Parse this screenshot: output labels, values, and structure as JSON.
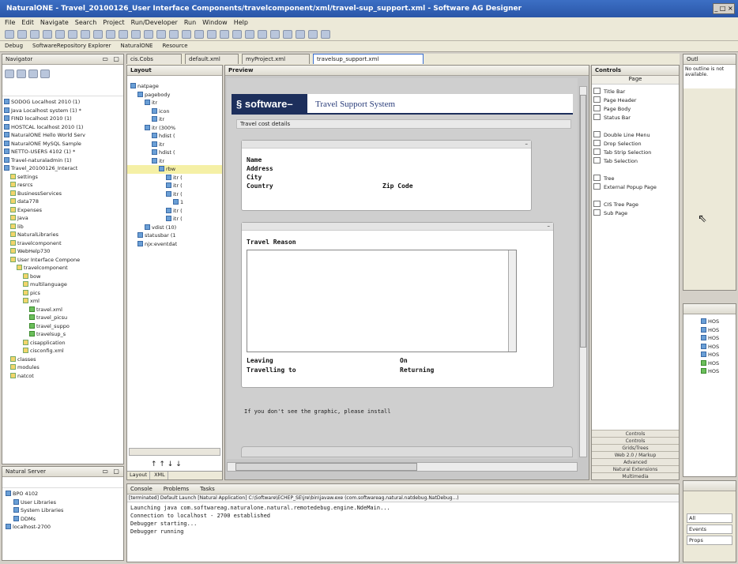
{
  "window": {
    "title": "NaturalONE - Travel_20100126_User Interface Components/travelcomponent/xml/travel-sup_support.xml - Software AG Designer",
    "controls": "_ □ ×"
  },
  "menu": [
    "File",
    "Edit",
    "Navigate",
    "Search",
    "Project",
    "Run/Developer",
    "Run",
    "Window",
    "Help"
  ],
  "perspectives": [
    "Debug",
    "SoftwareRepository Explorer",
    "NaturalONE",
    "Resource"
  ],
  "navigator": {
    "title": "Navigator",
    "items": [
      {
        "label": "SODOG Localhost 2010 (1)",
        "ind": 0,
        "ic": "p"
      },
      {
        "label": "Java Localhost system (1) *",
        "ind": 0,
        "ic": "p"
      },
      {
        "label": "FIND localhost 2010 (1)",
        "ind": 0,
        "ic": "p"
      },
      {
        "label": "HOSTCAL localhost 2010 (1)",
        "ind": 0,
        "ic": "p"
      },
      {
        "label": "NaturalONE Hello World Serv",
        "ind": 0,
        "ic": "p"
      },
      {
        "label": "NaturalONE MySQL Sample",
        "ind": 0,
        "ic": "p"
      },
      {
        "label": "NETTO-USERS 4102 (1) *",
        "ind": 0,
        "ic": "p"
      },
      {
        "label": "Travel-naturaladmin (1)",
        "ind": 0,
        "ic": "p"
      },
      {
        "label": "Travel_20100126_Interact",
        "ind": 0,
        "ic": "p"
      },
      {
        "label": "settings",
        "ind": 1,
        "ic": ""
      },
      {
        "label": "resrcs",
        "ind": 1,
        "ic": ""
      },
      {
        "label": "BusinessServices",
        "ind": 1,
        "ic": ""
      },
      {
        "label": "data778",
        "ind": 1,
        "ic": ""
      },
      {
        "label": "Expenses",
        "ind": 1,
        "ic": ""
      },
      {
        "label": "Java",
        "ind": 1,
        "ic": ""
      },
      {
        "label": "lib",
        "ind": 1,
        "ic": ""
      },
      {
        "label": "NaturalLibraries",
        "ind": 1,
        "ic": ""
      },
      {
        "label": "travelcomponent",
        "ind": 1,
        "ic": ""
      },
      {
        "label": "WebHelp730",
        "ind": 1,
        "ic": ""
      },
      {
        "label": "User Interface Compone",
        "ind": 1,
        "ic": ""
      },
      {
        "label": "travelcomponent",
        "ind": 2,
        "ic": ""
      },
      {
        "label": "bow",
        "ind": 3,
        "ic": ""
      },
      {
        "label": "multilanguage",
        "ind": 3,
        "ic": ""
      },
      {
        "label": "pics",
        "ind": 3,
        "ic": ""
      },
      {
        "label": "xml",
        "ind": 3,
        "ic": ""
      },
      {
        "label": "travel.xml",
        "ind": 4,
        "ic": "g"
      },
      {
        "label": "travel_picsu",
        "ind": 4,
        "ic": "g"
      },
      {
        "label": "travel_suppo",
        "ind": 4,
        "ic": "g"
      },
      {
        "label": "travelsup_s",
        "ind": 4,
        "ic": "g"
      },
      {
        "label": "cisapplication",
        "ind": 3,
        "ic": ""
      },
      {
        "label": "cisconfig.xml",
        "ind": 3,
        "ic": ""
      },
      {
        "label": "classes",
        "ind": 1,
        "ic": ""
      },
      {
        "label": "modules",
        "ind": 1,
        "ic": ""
      },
      {
        "label": "natcot",
        "ind": 1,
        "ic": ""
      }
    ]
  },
  "naturalservers": {
    "title": "Natural Server",
    "items": [
      {
        "label": "BPO 4102",
        "ind": 0
      },
      {
        "label": "User Libraries",
        "ind": 1
      },
      {
        "label": "System Libraries",
        "ind": 1
      },
      {
        "label": "DDMs",
        "ind": 1
      },
      {
        "label": "localhost-2700",
        "ind": 0
      }
    ]
  },
  "editortabs": [
    "cis.Cobs",
    "default.xml",
    "myProject.xml",
    "travelsup_support.xml"
  ],
  "layout": {
    "title": "Layout",
    "items": [
      {
        "label": "natpage",
        "ind": 0
      },
      {
        "label": "pagebody",
        "ind": 1
      },
      {
        "label": "itr",
        "ind": 2
      },
      {
        "label": "icon",
        "ind": 3
      },
      {
        "label": "itr",
        "ind": 3
      },
      {
        "label": "itr (300%",
        "ind": 2
      },
      {
        "label": "hdist (",
        "ind": 3
      },
      {
        "label": "itr",
        "ind": 3
      },
      {
        "label": "hdist (",
        "ind": 3
      },
      {
        "label": "itr",
        "ind": 3
      },
      {
        "label": "rbw",
        "ind": 4
      },
      {
        "label": "itr (",
        "ind": 5
      },
      {
        "label": "itr (",
        "ind": 5
      },
      {
        "label": "itr (",
        "ind": 5
      },
      {
        "label": "1",
        "ind": 6
      },
      {
        "label": "itr (",
        "ind": 5
      },
      {
        "label": "itr (",
        "ind": 5
      },
      {
        "label": "vdist (10)",
        "ind": 2
      },
      {
        "label": "statusbar (1",
        "ind": 1
      },
      {
        "label": "njx:eventdat",
        "ind": 1
      }
    ],
    "bottomtabs": [
      "Layout",
      "XML"
    ],
    "arrows": "↑ ↑ ↓ ↓"
  },
  "preview": {
    "title": "Preview",
    "logo": "software",
    "app_title": "Travel Support System",
    "section1": "Travel cost details",
    "fields1": {
      "name": "Name",
      "address": "Address",
      "city": "City",
      "country": "Country",
      "zip": "Zip Code"
    },
    "travel_reason": "Travel Reason",
    "fields2": {
      "leaving": "Leaving",
      "on": "On",
      "travelling": "Travelling to",
      "returning": "Returning"
    },
    "graphic_note": "If you don't see the graphic, please install"
  },
  "controls": {
    "title": "Controls",
    "header": "Page",
    "items": [
      "Title Bar",
      "Page Header",
      "Page Body",
      "Status Bar",
      "",
      "Double Line Menu",
      "Drop Selection",
      "Tab Strip Selection",
      "Tab Selection",
      "",
      "Tree",
      "External Popup Page",
      "",
      "CIS Tree Page",
      "Sub Page"
    ],
    "categories": [
      "Controls",
      "Controls",
      "Grids/Trees",
      "Web 2.0 / Markup",
      "Advanced",
      "Natural Extensions",
      "Multimedia"
    ]
  },
  "outline": {
    "title": "Outl",
    "msg": "No outline is not available."
  },
  "console": {
    "tabs": [
      "Console",
      "Problems",
      "Tasks"
    ],
    "header": "[terminated] Default Launch [Natural Application] C:\\Software\\ECHEP_SE\\jre\\bin\\javaw.exe (com.softwareag.natural.natdebug.NatDebug...)",
    "lines": [
      "Launching java com.softwareag.naturalone.natural.remotedebug.engine.NdeMain...",
      "Connection to localhost - 2700 established",
      "Debugger starting...",
      "Debugger running"
    ]
  },
  "rightbottom": {
    "labels": [
      "All",
      "Events",
      "Props"
    ]
  },
  "colors": {
    "accent": "#3a6fd0",
    "panel": "#ece9d8",
    "preview_grey": "#cfcfcf"
  }
}
